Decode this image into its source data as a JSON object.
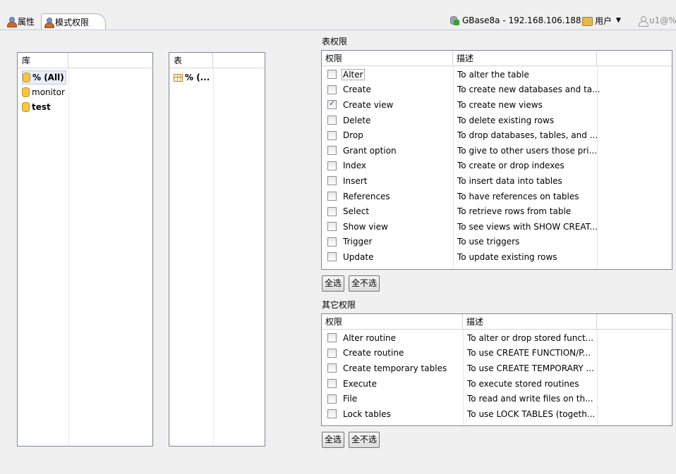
{
  "tabs": [
    {
      "label": "属性",
      "icon": "user-icon"
    },
    {
      "label": "模式权限",
      "icon": "user-icon"
    }
  ],
  "connection": {
    "label": "GBase8a - 192.168.106.188",
    "icon": "database-connected-icon"
  },
  "user_menu": {
    "label": "用户",
    "icon": "users-icon"
  },
  "current_user": {
    "label": "u1@%",
    "icon": "user-outline-icon"
  },
  "library_panel": {
    "title": "库",
    "header": "库",
    "items": [
      {
        "label": "% (All)",
        "bold": true,
        "selected": true
      },
      {
        "label": "monitor",
        "bold": false
      },
      {
        "label": "test",
        "bold": true
      }
    ]
  },
  "table_panel": {
    "title": "表",
    "header": "表",
    "items": [
      {
        "label": "% (..."
      }
    ]
  },
  "table_privileges": {
    "title": "表权限",
    "col_privilege": "权限",
    "col_description": "描述",
    "rows": [
      {
        "name": "Alter",
        "desc": "To alter the table",
        "checked": false
      },
      {
        "name": "Create",
        "desc": "To create new databases and ta...",
        "checked": false
      },
      {
        "name": "Create view",
        "desc": "To create new views",
        "checked": true
      },
      {
        "name": "Delete",
        "desc": "To delete existing rows",
        "checked": false
      },
      {
        "name": "Drop",
        "desc": "To drop databases, tables, and ...",
        "checked": false
      },
      {
        "name": "Grant option",
        "desc": "To give to other users those pri...",
        "checked": false
      },
      {
        "name": "Index",
        "desc": "To create or drop indexes",
        "checked": false
      },
      {
        "name": "Insert",
        "desc": "To insert data into tables",
        "checked": false
      },
      {
        "name": "References",
        "desc": "To have references on tables",
        "checked": false
      },
      {
        "name": "Select",
        "desc": "To retrieve rows from table",
        "checked": false
      },
      {
        "name": "Show view",
        "desc": "To see views with SHOW CREAT...",
        "checked": false
      },
      {
        "name": "Trigger",
        "desc": "To use triggers",
        "checked": false
      },
      {
        "name": "Update",
        "desc": "To update existing rows",
        "checked": false
      }
    ],
    "select_all": "全选",
    "select_none": "全不选"
  },
  "other_privileges": {
    "title": "其它权限",
    "col_privilege": "权限",
    "col_description": "描述",
    "rows": [
      {
        "name": "Alter routine",
        "desc": "To alter or drop stored funct...",
        "checked": false
      },
      {
        "name": "Create routine",
        "desc": "To use CREATE FUNCTION/P...",
        "checked": false
      },
      {
        "name": "Create temporary tables",
        "desc": "To use CREATE TEMPORARY ...",
        "checked": false
      },
      {
        "name": "Execute",
        "desc": "To execute stored routines",
        "checked": false
      },
      {
        "name": "File",
        "desc": "To read and write files on th...",
        "checked": false
      },
      {
        "name": "Lock tables",
        "desc": "To use LOCK TABLES (togeth...",
        "checked": false
      }
    ],
    "select_all": "全选",
    "select_none": "全不选"
  }
}
